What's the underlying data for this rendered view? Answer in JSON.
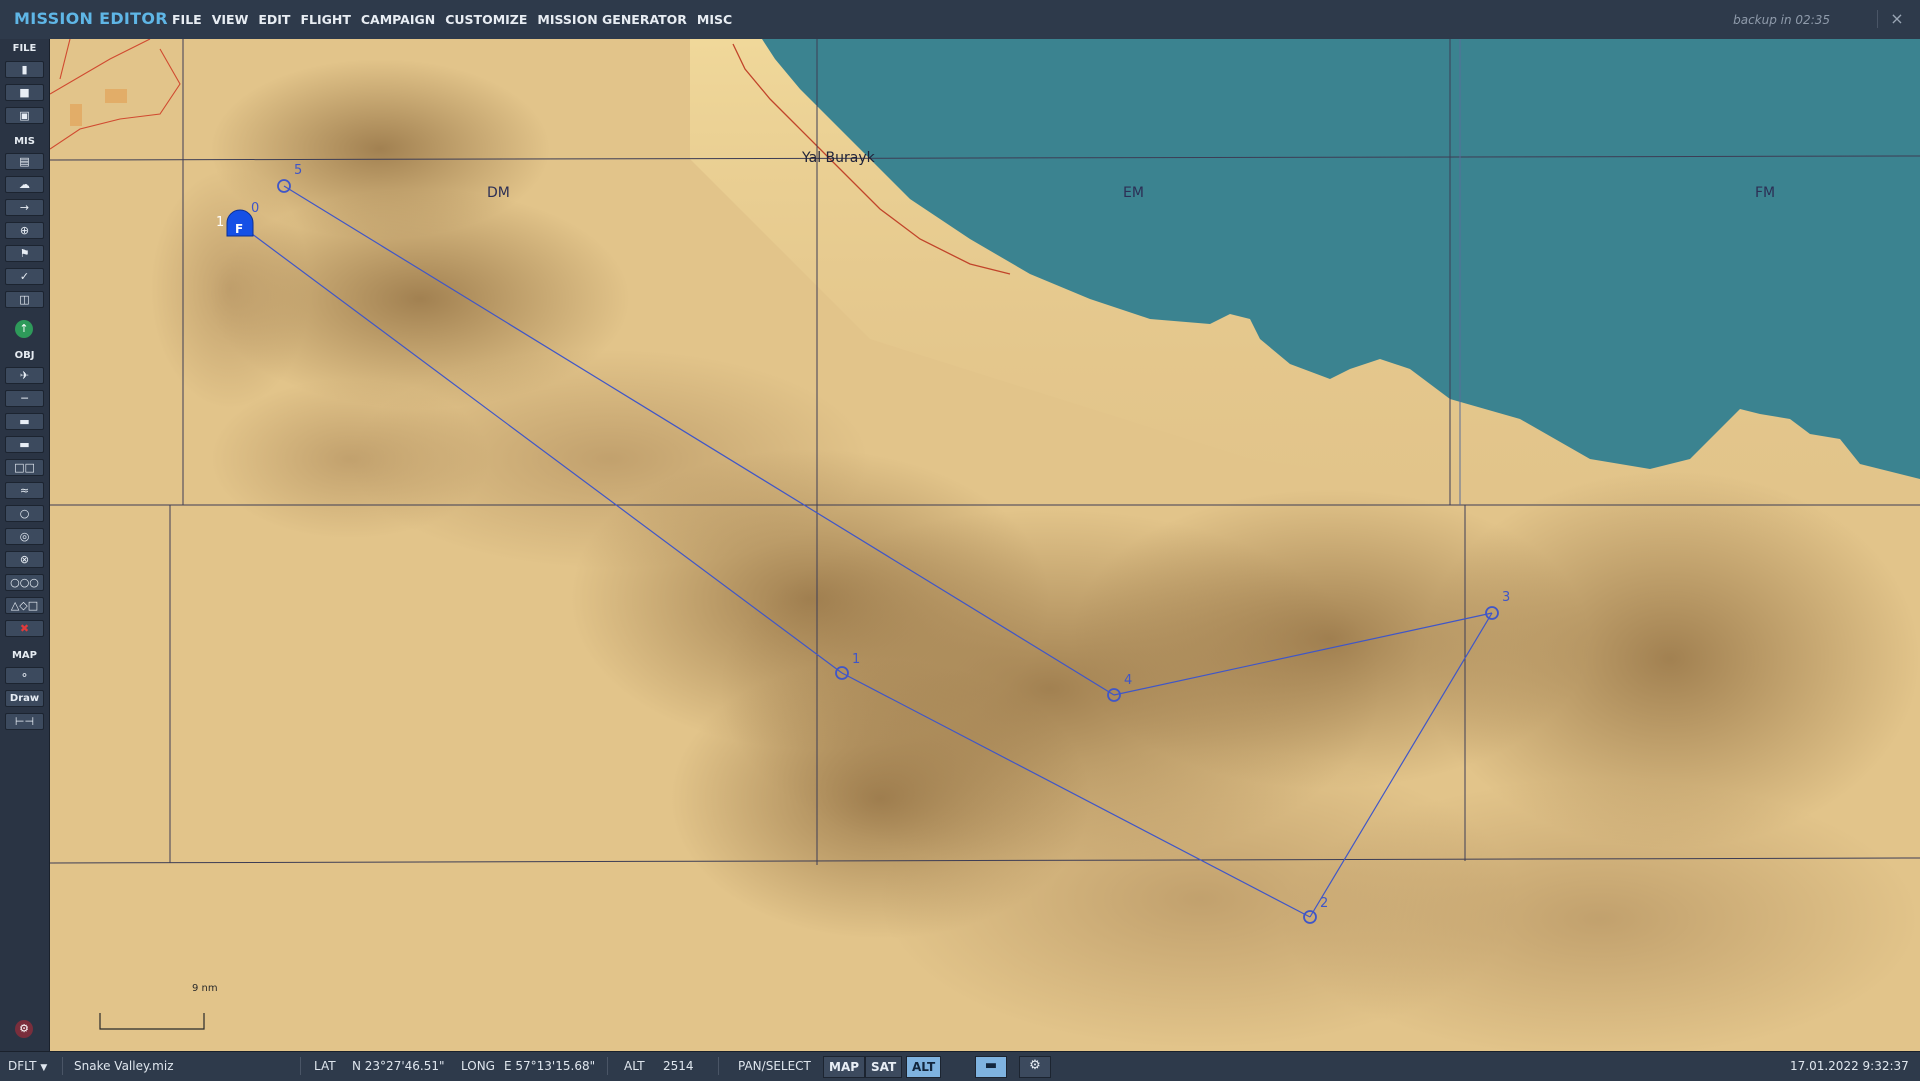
{
  "app": {
    "title": "MISSION EDITOR",
    "menu": [
      "FILE",
      "VIEW",
      "EDIT",
      "FLIGHT",
      "CAMPAIGN",
      "CUSTOMIZE",
      "MISSION GENERATOR",
      "MISC"
    ],
    "backup": "backup in 02:35",
    "close": "×"
  },
  "toolbar": {
    "sections": {
      "file": "FILE",
      "mis": "MIS",
      "obj": "OBJ",
      "map": "MAP"
    },
    "draw_label": "Draw"
  },
  "map": {
    "grid_labels": [
      "DM",
      "EM",
      "FM"
    ],
    "place": "Yal Burayk",
    "scale": "9 nm",
    "group_label": "1",
    "unit_symbol": "F",
    "waypoints": [
      "0",
      "1",
      "2",
      "3",
      "4",
      "5"
    ],
    "colors": {
      "sea": "#3b8390",
      "route": "#3f56c8",
      "unit": "#1550e6",
      "sand": "#e2c48a"
    }
  },
  "status": {
    "profile": "DFLT",
    "file": "Snake Valley.miz",
    "lat_label": "LAT",
    "lat": "N 23°27'46.51\"",
    "long_label": "LONG",
    "long": "E 57°13'15.68\"",
    "alt_label": "ALT",
    "alt": "2514",
    "mode": "PAN/SELECT",
    "map_btn": "MAP",
    "sat_btn": "SAT",
    "alt_btn": "ALT",
    "datetime": "17.01.2022 9:32:37"
  }
}
